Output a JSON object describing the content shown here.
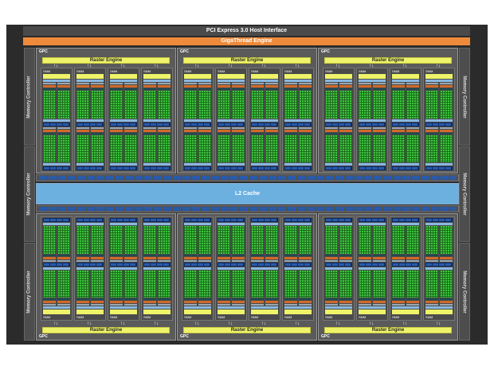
{
  "host_interface": "PCI Express 3.0 Host Interface",
  "gigathread": "GigaThread Engine",
  "memory_controller": "Memory Controller",
  "l2_cache": "L2 Cache",
  "gpc_label": "GPC",
  "raster_engine": "Raster Engine",
  "sm_label": "SMM",
  "arrows": "↑↓",
  "colors": {
    "frame": "#2b2b2b",
    "gigathread": "#ee8a3a",
    "raster": "#eef36a",
    "l2": "#6cb0e0",
    "cores": "#3ec43e"
  }
}
